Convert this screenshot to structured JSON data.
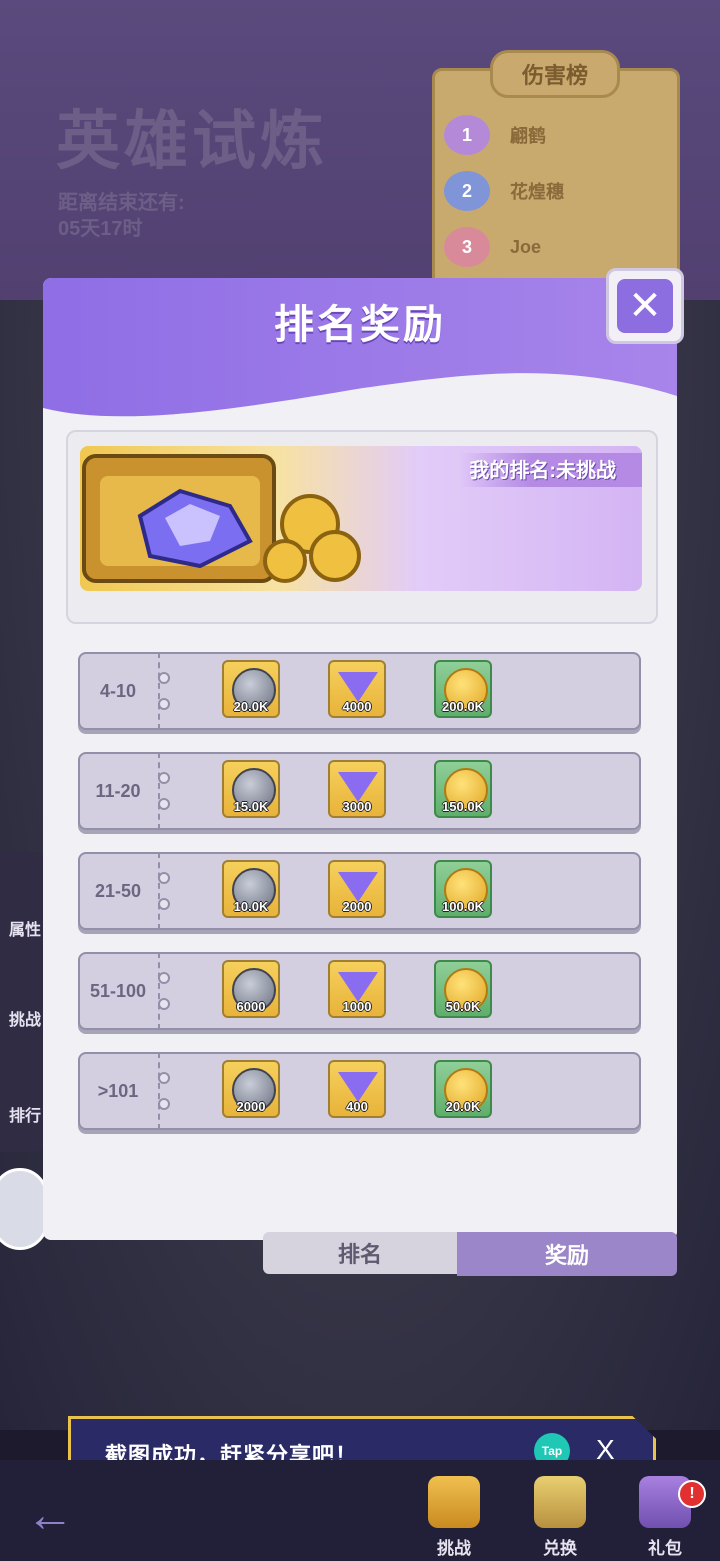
{
  "screen": {
    "title": "英雄试炼",
    "countdown_label": "距离结束还有:",
    "countdown_value": "05天17时"
  },
  "damage_board": {
    "title": "伤害榜",
    "entries": [
      {
        "rank": "1",
        "name": "翩鹤"
      },
      {
        "rank": "2",
        "name": "花煌穗"
      },
      {
        "rank": "3",
        "name": "Joe"
      }
    ]
  },
  "side_menu": {
    "items": [
      {
        "label": "属性"
      },
      {
        "label": "挑战"
      },
      {
        "label": "排行"
      }
    ]
  },
  "modal": {
    "title": "排名奖励",
    "close_label": "✕",
    "my_rank": "我的排名:未挑战",
    "rewards": [
      {
        "range": "4-10",
        "items": [
          {
            "type": "silver",
            "qty": "20.0K"
          },
          {
            "type": "gem",
            "qty": "4000"
          },
          {
            "type": "coin",
            "qty": "200.0K"
          }
        ]
      },
      {
        "range": "11-20",
        "items": [
          {
            "type": "silver",
            "qty": "15.0K"
          },
          {
            "type": "gem",
            "qty": "3000"
          },
          {
            "type": "coin",
            "qty": "150.0K"
          }
        ]
      },
      {
        "range": "21-50",
        "items": [
          {
            "type": "silver",
            "qty": "10.0K"
          },
          {
            "type": "gem",
            "qty": "2000"
          },
          {
            "type": "coin",
            "qty": "100.0K"
          }
        ]
      },
      {
        "range": "51-100",
        "items": [
          {
            "type": "silver",
            "qty": "6000"
          },
          {
            "type": "gem",
            "qty": "1000"
          },
          {
            "type": "coin",
            "qty": "50.0K"
          }
        ]
      },
      {
        "range": ">101",
        "items": [
          {
            "type": "silver",
            "qty": "2000"
          },
          {
            "type": "gem",
            "qty": "400"
          },
          {
            "type": "coin",
            "qty": "20.0K"
          }
        ]
      }
    ]
  },
  "tabs": {
    "rank": "排名",
    "reward": "奖励"
  },
  "toast": {
    "message": "截图成功，赶紧分享吧！",
    "tap_label": "Tap",
    "close_label": "X"
  },
  "bottom_nav": {
    "back_icon": "←",
    "items": [
      {
        "label": "挑战"
      },
      {
        "label": "兑换"
      },
      {
        "label": "礼包"
      }
    ],
    "gift_badge": "!"
  },
  "colors": {
    "accent_purple": "#8d6ee0",
    "gold": "#e8b33a",
    "toast_bg": "#2a2a66"
  }
}
